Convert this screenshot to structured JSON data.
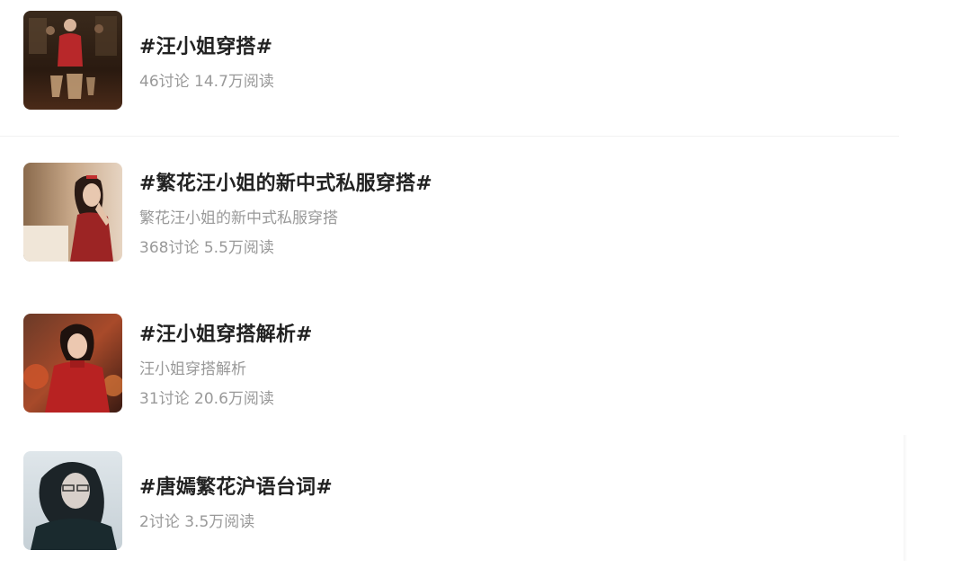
{
  "topics": [
    {
      "title": "#汪小姐穿搭#",
      "description": "",
      "stats": "46讨论 14.7万阅读",
      "thumbnail": "poster-image"
    },
    {
      "title": "#繁花汪小姐的新中式私服穿搭#",
      "description": "繁花汪小姐的新中式私服穿搭",
      "stats": "368讨论 5.5万阅读",
      "thumbnail": "portrait-image"
    },
    {
      "title": "#汪小姐穿搭解析#",
      "description": "汪小姐穿搭解析",
      "stats": "31讨论 20.6万阅读",
      "thumbnail": "portrait-image"
    },
    {
      "title": "#唐嫣繁花沪语台词#",
      "description": "",
      "stats": "2讨论 3.5万阅读",
      "thumbnail": "portrait-image"
    }
  ],
  "colors": {
    "title": "#222222",
    "meta": "#999999",
    "divider": "#f1f1f1"
  }
}
